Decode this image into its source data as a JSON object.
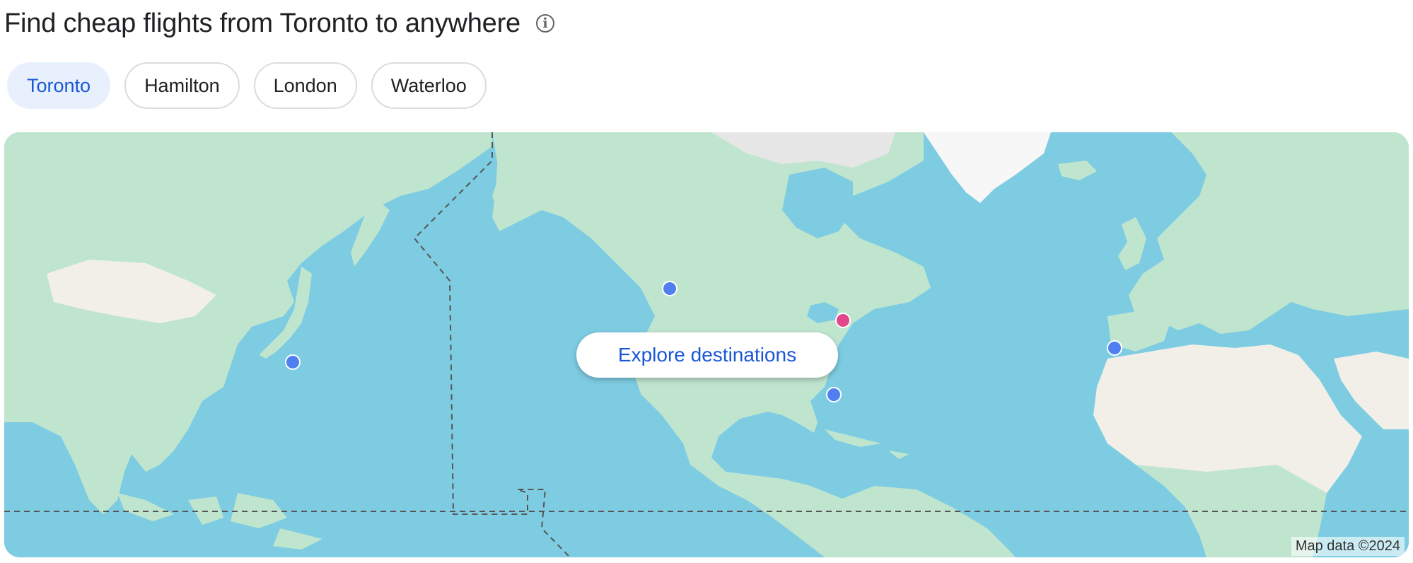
{
  "header": {
    "title": "Find cheap flights from Toronto to anywhere"
  },
  "icons": {
    "info": "info-circle-icon"
  },
  "chips": [
    {
      "label": "Toronto",
      "selected": true
    },
    {
      "label": "Hamilton",
      "selected": false
    },
    {
      "label": "London",
      "selected": false
    },
    {
      "label": "Waterloo",
      "selected": false
    }
  ],
  "map": {
    "explore_label": "Explore destinations",
    "attribution": "Map data ©2024",
    "colors": {
      "water": "#7ecce2",
      "land": "#bfe5cf",
      "desert": "#f1efe8",
      "ice": "#f7f7f7",
      "origin_pin": "#e2468c",
      "destination_pin": "#4f7ff0"
    }
  }
}
